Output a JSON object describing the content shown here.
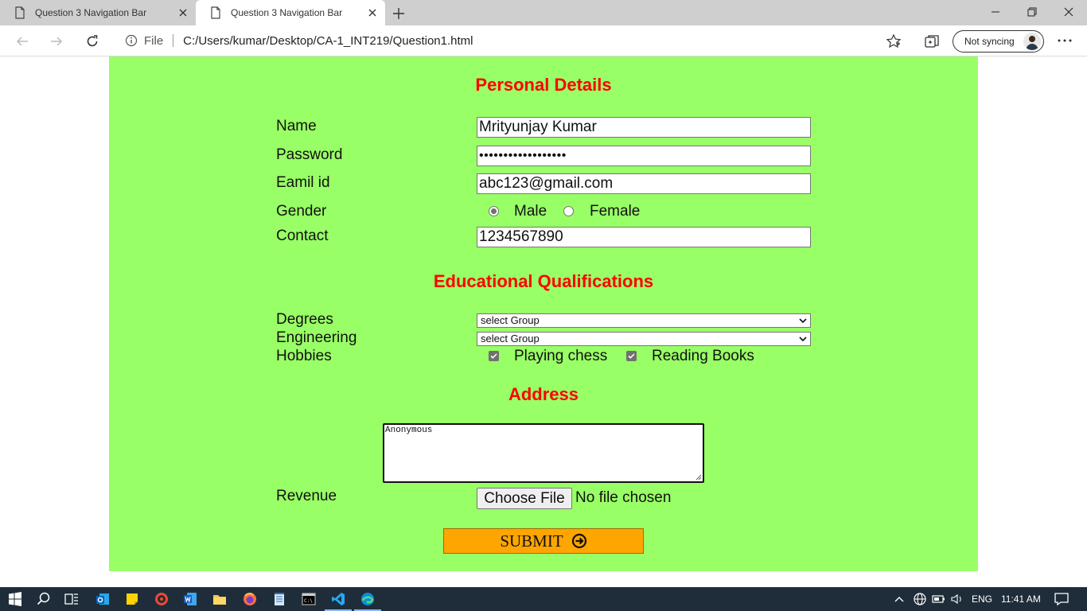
{
  "browser": {
    "tabs": [
      {
        "title": "Question 3 Navigation Bar",
        "active": false
      },
      {
        "title": "Question 3 Navigation Bar",
        "active": true
      }
    ],
    "address": {
      "scheme_label": "File",
      "url": "C:/Users/kumar/Desktop/CA-1_INT219/Question1.html"
    },
    "profile": {
      "sync_label": "Not syncing"
    },
    "icons": [
      "page-icon",
      "close-icon",
      "plus-icon",
      "minimize-icon",
      "restore-icon",
      "window-close-icon",
      "back-icon",
      "forward-icon",
      "refresh-icon",
      "info-icon",
      "star-icon",
      "collections-icon",
      "more-icon"
    ]
  },
  "form": {
    "personal": {
      "title": "Personal Details",
      "name_label": "Name",
      "name_value": "Mrityunjay Kumar",
      "password_label": "Password",
      "password_value": "••••••••••••••••••",
      "email_label": "Eamil id",
      "email_value": "abc123@gmail.com",
      "gender_label": "Gender",
      "gender_options": [
        "Male",
        "Female"
      ],
      "gender_selected": "Male",
      "contact_label": "Contact",
      "contact_value": "1234567890"
    },
    "education": {
      "title": "Educational Qualifications",
      "degrees_label": "Degrees",
      "degrees_selected": "select Group",
      "engineering_label": "Engineering",
      "engineering_selected": "select Group",
      "hobbies_label": "Hobbies",
      "hobbies": [
        {
          "label": "Playing chess",
          "checked": true
        },
        {
          "label": "Reading Books",
          "checked": true
        }
      ]
    },
    "address": {
      "title": "Address",
      "value": "Anonymous"
    },
    "revenue": {
      "label": "Revenue",
      "button_label": "Choose File",
      "status": "No file chosen"
    },
    "submit_label": "SUBMIT"
  },
  "colors": {
    "page_bg": "#99ff66",
    "heading": "#ff0000",
    "submit_bg": "#ffa500",
    "taskbar_bg": "#1f2d3a"
  },
  "taskbar": {
    "language": "ENG",
    "time": "11:41 AM",
    "icons": [
      "windows-start-icon",
      "search-icon",
      "task-view-icon",
      "outlook-icon",
      "sticky-notes-icon",
      "media-icon",
      "word-icon",
      "file-explorer-icon",
      "firefox-icon",
      "notepad-icon",
      "terminal-icon",
      "vscode-icon",
      "edge-icon"
    ]
  }
}
